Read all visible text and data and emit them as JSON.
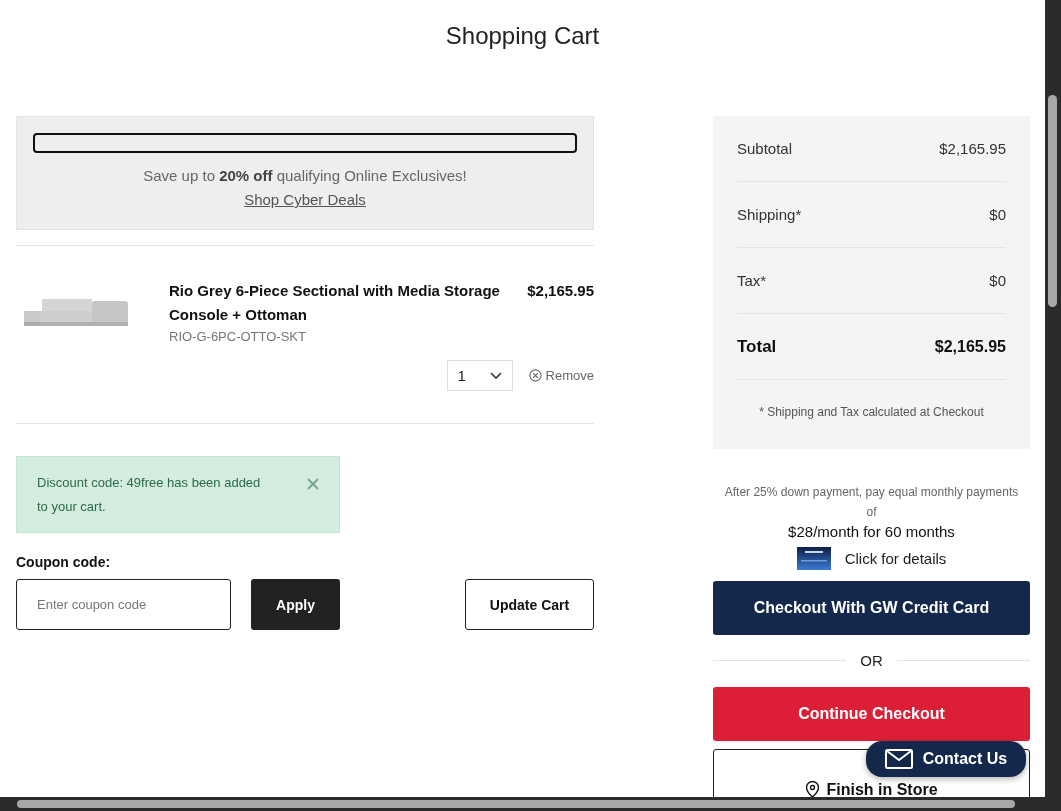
{
  "page_title": "Shopping Cart",
  "promo": {
    "level": 0,
    "message": "Save up to **20% off** qualifying Online Exclusives!",
    "link": "Shop Cyber Deals"
  },
  "cart_items": [
    {
      "name": "Rio Grey 6-Piece Sectional with Media Storage Console + Ottoman",
      "sku": "RIO-G-6PC-OTTO-SKT",
      "price": "$2,165.95",
      "quantity": "1",
      "remove": "Remove"
    }
  ],
  "alert": {
    "message": "Discount code: 49free has been added to your cart."
  },
  "coupon": {
    "label": "Coupon code:",
    "placeholder": "Enter coupon code",
    "apply": "Apply",
    "update": "Update Cart"
  },
  "summary": {
    "rows": [
      {
        "label": "Subtotal",
        "value": "$2,165.95",
        "kind": "normal"
      },
      {
        "label": "Shipping*",
        "value": "$0",
        "kind": "normal"
      },
      {
        "label": "Tax*",
        "value": "$0",
        "kind": "normal"
      },
      {
        "label": "Total",
        "value": "$2,165.95",
        "kind": "total"
      }
    ],
    "note": "* Shipping and Tax calculated at Checkout"
  },
  "financing": {
    "intro": "After 25% down payment, pay equal monthly payments of",
    "offer": "$28/month for 60 months",
    "details": "Click for details"
  },
  "checkout": {
    "credit_button": "Checkout With GW Credit Card",
    "separator": "OR",
    "continue_button": "Continue Checkout",
    "store_button": "Finish in Store"
  },
  "contact": {
    "label": "Contact Us"
  }
}
